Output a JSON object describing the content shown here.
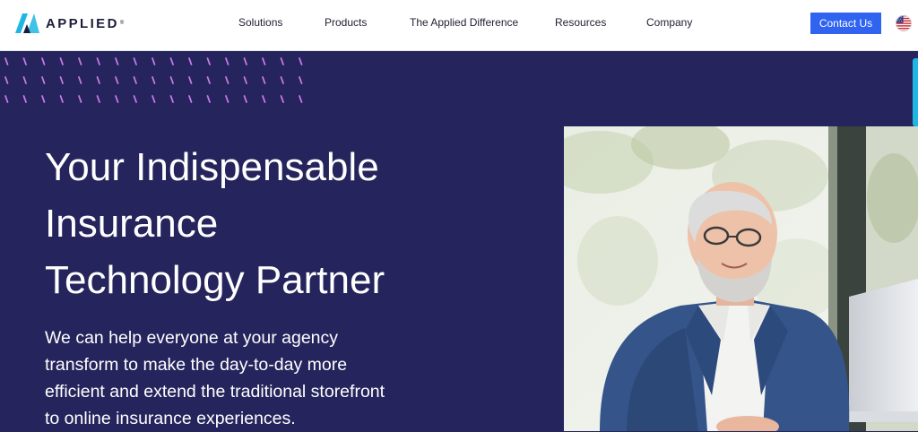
{
  "brand": {
    "name": "APPLIED",
    "trademark": "®",
    "logo_icon": "applied-chevron-logo",
    "colors": {
      "teal": "#1fb6e4",
      "navy": "#25245c",
      "ink": "#1c1c3a",
      "accent_blue": "#2f63f0",
      "pattern_pink": "#c77be8"
    }
  },
  "nav": {
    "items": [
      {
        "label": "Solutions"
      },
      {
        "label": "Products"
      },
      {
        "label": "The Applied Difference"
      },
      {
        "label": "Resources"
      },
      {
        "label": "Company"
      }
    ],
    "contact_label": "Contact Us",
    "region_icon": "us-flag-icon"
  },
  "hero": {
    "title_lines": [
      "Your Indispensable",
      "Insurance",
      "Technology Partner"
    ],
    "body_lines": [
      "We can help everyone at your agency",
      "transform to make the day-to-day more",
      "efficient and extend the traditional storefront",
      "to online insurance experiences."
    ],
    "photo_icon": "smiling-businessman-photo"
  }
}
